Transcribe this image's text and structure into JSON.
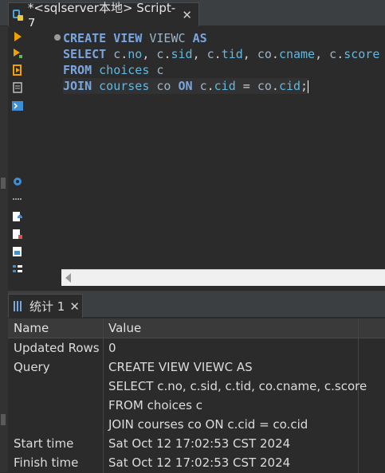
{
  "editor_tab": {
    "title": "*<sqlserver本地> Script-7",
    "close": "✕"
  },
  "sql": {
    "line1": {
      "kw1": "CREATE",
      "kw2": "VIEW",
      "name": "VIEWC",
      "kw3": "AS"
    },
    "line2": {
      "kw": "SELECT",
      "a1": "c",
      "f1": "no",
      "a2": "c",
      "f2": "sid",
      "a3": "c",
      "f3": "tid",
      "a4": "co",
      "f4": "cname",
      "a5": "c",
      "f5": "score"
    },
    "line3": {
      "kw": "FROM",
      "table": "choices",
      "alias": "c"
    },
    "line4": {
      "kw1": "JOIN",
      "table": "courses",
      "alias": "co",
      "kw2": "ON",
      "a1": "c",
      "f1": "cid",
      "eq": "=",
      "a2": "co",
      "f2": "cid",
      "semi": ";"
    }
  },
  "results_tab": {
    "title": "统计 1",
    "close": "✕"
  },
  "grid": {
    "headers": [
      "Name",
      "Value"
    ],
    "rows": [
      {
        "name": "Updated Rows",
        "value": "0"
      },
      {
        "name": "Query",
        "value": "CREATE VIEW VIEWC AS"
      },
      {
        "name": "",
        "value": "SELECT c.no, c.sid, c.tid, co.cname, c.score"
      },
      {
        "name": "",
        "value": "FROM choices c"
      },
      {
        "name": "",
        "value": "JOIN courses co ON c.cid = co.cid"
      },
      {
        "name": "Start time",
        "value": "Sat Oct 12 17:02:53 CST 2024"
      },
      {
        "name": "Finish time",
        "value": "Sat Oct 12 17:02:53 CST 2024"
      }
    ]
  },
  "colors": {
    "accent": "#7aa6e0",
    "run": "#f0a000",
    "toolbar_blue": "#3d8fd6"
  }
}
